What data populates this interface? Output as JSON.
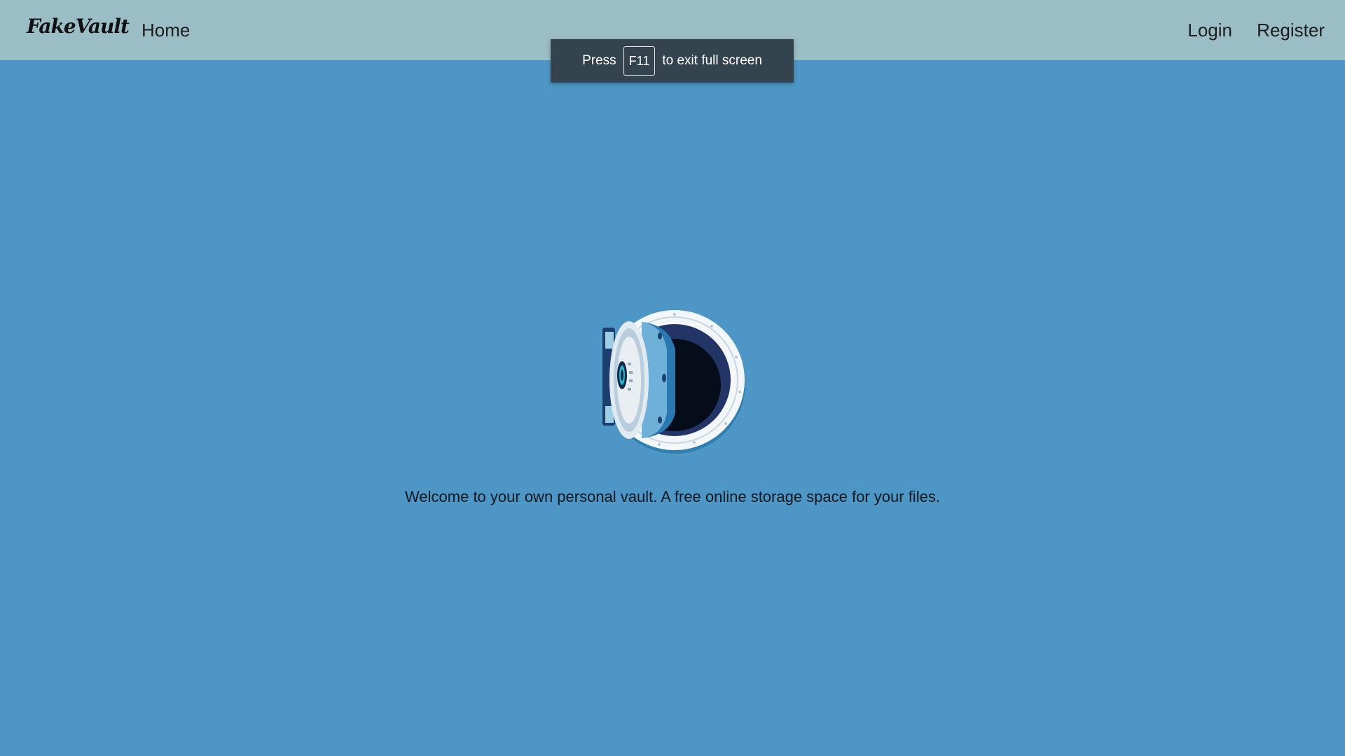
{
  "navbar": {
    "brand": "FakeVault",
    "home_label": "Home",
    "login_label": "Login",
    "register_label": "Register"
  },
  "fullscreen_notice": {
    "prefix": "Press",
    "key": "F11",
    "suffix": "to exit full screen"
  },
  "hero": {
    "image_icon": "vault-door-icon",
    "tagline": "Welcome to your own personal vault. A free online storage space for your files."
  },
  "colors": {
    "navbar_bg": "#9bbdc6",
    "page_bg": "#4d96c5",
    "notice_bg": "#34444f"
  }
}
